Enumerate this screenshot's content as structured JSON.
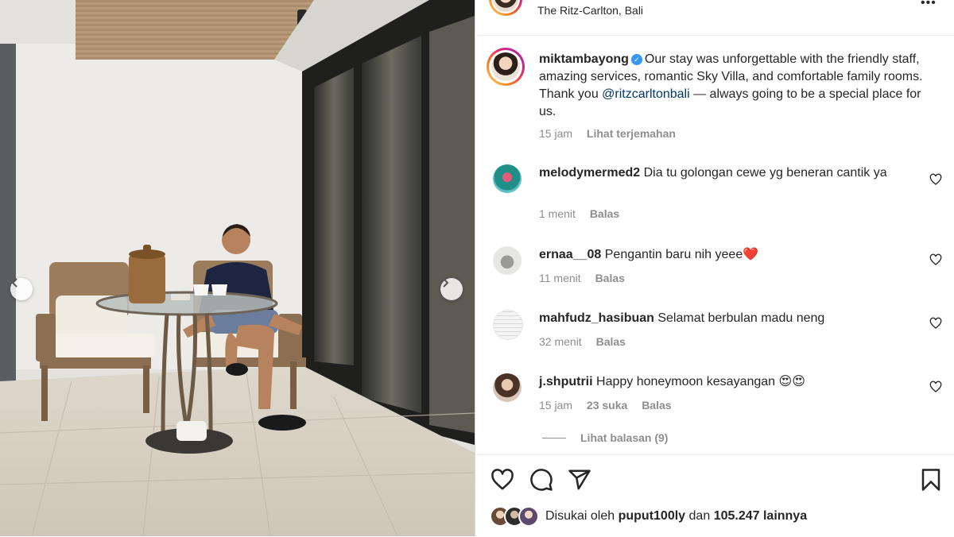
{
  "post": {
    "location": "The Ritz-Carlton, Bali",
    "author": "miktambayong",
    "caption_before_mention": "Our stay was unforgettable with the friendly staff, amazing services, romantic Sky Villa, and comfortable family rooms. Thank you ",
    "mention": "@ritzcarltonbali",
    "caption_after_mention": " — always going to be a special place for us.",
    "time": "15 jam",
    "translate_label": "Lihat terjemahan"
  },
  "comments": [
    {
      "username": "melodymermed2",
      "text": "Dia tu golongan cewe yg beneran cantik ya",
      "time": "1 menit",
      "likes": "",
      "reply_label": "Balas"
    },
    {
      "username": "ernaa__08",
      "text": "Pengantin baru nih yeee❤️",
      "time": "11 menit",
      "likes": "",
      "reply_label": "Balas"
    },
    {
      "username": "mahfudz_hasibuan",
      "text": "Selamat berbulan madu neng",
      "time": "32 menit",
      "likes": "",
      "reply_label": "Balas"
    },
    {
      "username": "j.shputrii",
      "text": "Happy honeymoon kesayangan 😍😍",
      "time": "15 jam",
      "likes": "23 suka",
      "reply_label": "Balas"
    }
  ],
  "view_replies_label": "Lihat balasan (9)",
  "likes": {
    "prefix": "Disukai oleh",
    "user": "puput100ly",
    "joiner": "dan",
    "count": "105.247 lainnya"
  },
  "icons": {
    "like": "heart-icon",
    "comment": "comment-icon",
    "share": "share-icon",
    "save": "bookmark-icon",
    "more": "more-icon",
    "verified": "verified-badge-icon",
    "carousel_prev": "chevron-left-icon",
    "carousel_next": "chevron-right-icon"
  },
  "colors": {
    "text": "#262626",
    "muted": "#8e8e8e",
    "mention": "#00376b",
    "verified": "#3897f0"
  }
}
